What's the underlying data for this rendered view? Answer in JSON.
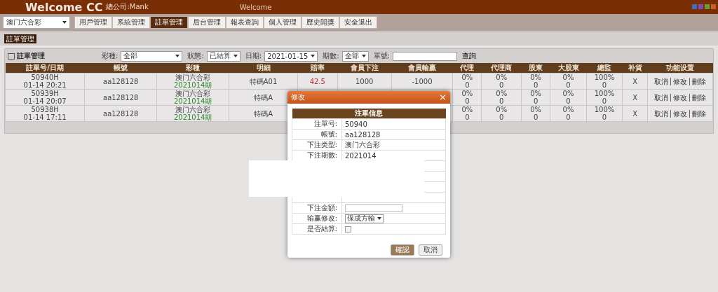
{
  "header": {
    "title": "Welcome CC",
    "subtitle": "總公司:Mank",
    "center_text": "Welcome",
    "swatches": [
      {
        "color": "#3f6fb8"
      },
      {
        "color": "#7a4fb0"
      },
      {
        "color": "#6f9a2e"
      },
      {
        "color": "#c8602a"
      }
    ]
  },
  "nav": {
    "lottery_select": "澳门六合彩",
    "items": [
      {
        "label": "用戶管理",
        "selected": false
      },
      {
        "label": "系統管理",
        "selected": false
      },
      {
        "label": "註單管理",
        "selected": true
      },
      {
        "label": "后台管理",
        "selected": false
      },
      {
        "label": "報表查詢",
        "selected": false
      },
      {
        "label": "個人管理",
        "selected": false
      },
      {
        "label": "歷史開獎",
        "selected": false
      },
      {
        "label": "安全退出",
        "selected": false
      }
    ]
  },
  "breadcrumb": "註單管理",
  "panel": {
    "title": "註單管理",
    "filters": [
      {
        "label": "彩種:",
        "value": "全部",
        "kind": "select"
      },
      {
        "label": "狀態:",
        "value": "已結算",
        "kind": "select"
      },
      {
        "label": "日期:",
        "value": "2021-01-15",
        "kind": "select"
      },
      {
        "label": "期數:",
        "value": "全部",
        "kind": "select"
      },
      {
        "label": "單號:",
        "kind": "input"
      }
    ],
    "search_button": "查詢"
  },
  "table": {
    "columns": [
      "註單号/日期",
      "帳號",
      "彩種",
      "明細",
      "賠率",
      "會員下注",
      "會員輸贏",
      "代理",
      "代理商",
      "股東",
      "大股東",
      "總監",
      "补貨",
      "功能设置"
    ],
    "rows": [
      {
        "cells": [
          [
            "50940H",
            "01-14 20:21"
          ],
          [
            "aa128128"
          ],
          [
            "澳门六合彩",
            "2021014期"
          ],
          [
            "特碼A01"
          ],
          [
            "42.5"
          ],
          [
            "1000"
          ],
          [
            "-1000"
          ],
          [
            "0%",
            "0"
          ],
          [
            "0%",
            "0"
          ],
          [
            "0%",
            "0"
          ],
          [
            "0%",
            "0"
          ],
          [
            "100%",
            "0"
          ],
          [
            "X"
          ]
        ],
        "actions": [
          "取消",
          "修改",
          "刪除"
        ]
      },
      {
        "cells": [
          [
            "50939H",
            "01-14 20:07"
          ],
          [
            "aa128128"
          ],
          [
            "澳门六合彩",
            "2021014期"
          ],
          [
            "特碼A"
          ],
          [],
          [],
          [],
          [
            "0%",
            "0"
          ],
          [
            "0%",
            "0"
          ],
          [
            "0%",
            "0"
          ],
          [
            "0%",
            "0"
          ],
          [
            "100%",
            "0"
          ],
          [
            "X"
          ]
        ],
        "actions": [
          "取消",
          "修改",
          "刪除"
        ]
      },
      {
        "cells": [
          [
            "50938H",
            "01-14 17:11"
          ],
          [
            "aa128128"
          ],
          [
            "澳门六合彩",
            "2021014期"
          ],
          [
            "特碼A"
          ],
          [],
          [],
          [],
          [
            "0%",
            "0"
          ],
          [
            "0%",
            "0"
          ],
          [
            "0%",
            "0"
          ],
          [
            "0%",
            "0"
          ],
          [
            "100%",
            "0"
          ],
          [
            "X"
          ]
        ],
        "actions": [
          "取消",
          "修改",
          "刪除"
        ]
      }
    ]
  },
  "modal": {
    "title": "修改",
    "close": "×",
    "section_title": "注單信息",
    "fields": [
      {
        "label": "注單号:",
        "value": "50940",
        "kind": "text"
      },
      {
        "label": "帳號:",
        "value": "aa128128",
        "kind": "text"
      },
      {
        "label": "下注类型:",
        "value": "澳门六合彩",
        "kind": "text"
      },
      {
        "label": "下注期數:",
        "value": "2021014",
        "kind": "text"
      },
      {
        "kind": "redacted"
      },
      {
        "kind": "redacted"
      },
      {
        "kind": "redacted"
      },
      {
        "kind": "redacted"
      },
      {
        "label": "下注金額:",
        "kind": "input"
      },
      {
        "label": "输赢修改:",
        "value": "保成方輸",
        "kind": "select"
      },
      {
        "label": "是否結算:",
        "kind": "checkbox",
        "checked": false
      }
    ],
    "buttons": [
      {
        "label": "確認",
        "kind": "primary"
      },
      {
        "label": "取消",
        "kind": "secondary"
      }
    ]
  }
}
